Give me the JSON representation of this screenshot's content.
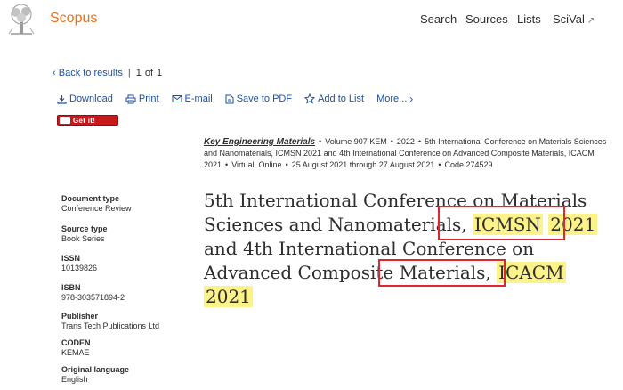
{
  "header": {
    "brand": "Scopus",
    "nav": [
      {
        "label": "Search"
      },
      {
        "label": "Sources"
      },
      {
        "label": "Lists"
      },
      {
        "label": "SciVal",
        "external": true
      }
    ]
  },
  "back": {
    "label": "Back to results",
    "index": "1",
    "of": "of",
    "total": "1"
  },
  "actions": {
    "download": "Download",
    "print": "Print",
    "email": "E-mail",
    "pdf": "Save to PDF",
    "list": "Add to List",
    "more": "More..."
  },
  "getit": {
    "label": "Get it!"
  },
  "source": {
    "journal": "Key Engineering Materials",
    "volume": "Volume 907 KEM",
    "year": "2022",
    "conference": "5th International Conference on Materials Sciences and Nanomaterials, ICMSN 2021 and 4th International Conference on Advanced Composite Materials, ICACM 2021",
    "location": "Virtual, Online",
    "dates": "25 August 2021 through 27 August 2021",
    "code": "Code 274529"
  },
  "meta": [
    {
      "label": "Document type",
      "value": "Conference Review"
    },
    {
      "label": "Source type",
      "value": "Book Series"
    },
    {
      "label": "ISSN",
      "value": "10139826"
    },
    {
      "label": "ISBN",
      "value": "978-303571894-2"
    },
    {
      "label": "Publisher",
      "value": "Trans Tech Publications Ltd"
    },
    {
      "label": "CODEN",
      "value": "KEMAE"
    },
    {
      "label": "Original language",
      "value": "English"
    }
  ],
  "title": {
    "p1": "5th International Conference on Materials Sciences and Nanomaterials,",
    "hl1": "ICMSN",
    "hl2": "2021",
    "p2": "and 4th International Conference on Advanced Composite Materials,",
    "hl3": "ICACM",
    "hl4": "2021"
  },
  "colors": {
    "brand": "#e9711c",
    "link": "#1f4fa0",
    "highlight": "#fbf28a",
    "annotation_box": "#e0262e"
  }
}
